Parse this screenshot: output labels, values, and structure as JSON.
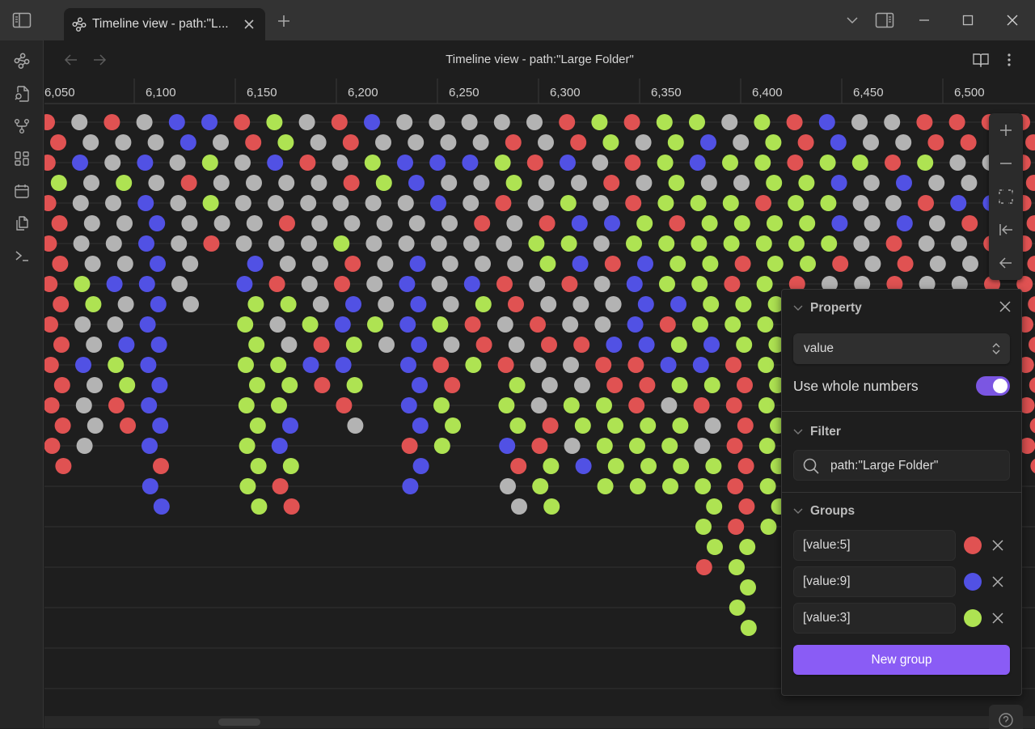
{
  "window": {
    "tab_title": "Timeline view - path:\"L...",
    "tab_icon": "graph-icon",
    "buttons": [
      "sidebar-left-toggle",
      "new-tab",
      "tab-list-dropdown",
      "sidebar-right-toggle",
      "minimize",
      "maximize",
      "close"
    ]
  },
  "ribbon": {
    "items": [
      {
        "name": "graph-view",
        "icon": "graph-icon"
      },
      {
        "name": "file-search",
        "icon": "file-search-icon"
      },
      {
        "name": "git-fork",
        "icon": "fork-icon"
      },
      {
        "name": "dashboard",
        "icon": "layout-grid-icon"
      },
      {
        "name": "calendar",
        "icon": "calendar-icon"
      },
      {
        "name": "copy-files",
        "icon": "copy-icon"
      },
      {
        "name": "command-palette",
        "icon": "terminal-icon"
      }
    ]
  },
  "view_header": {
    "title": "Timeline view - path:\"Large Folder\"",
    "actions": [
      "reading-view",
      "more-options"
    ]
  },
  "timeline": {
    "axis_ticks": [
      "6,050",
      "6,100",
      "6,150",
      "6,200",
      "6,250",
      "6,300",
      "6,350",
      "6,400",
      "6,450",
      "6,500"
    ],
    "colors": {
      "red": "#e05252",
      "blue": "#5151e4",
      "green": "#aee352",
      "gray": "#b3b3b3"
    },
    "legend": {
      "R": "value:5",
      "B": "value:9",
      "G": "value:3",
      "W": "other"
    },
    "columns": [
      {
        "stack": "RRRGRRRRRRRRRRRRRR"
      },
      {
        "stack": "WWBWWWWWGGWWBWWWW"
      },
      {
        "stack": "RWWGWWWWBWWBGGRR"
      },
      {
        "stack": "WWBWBBBBBBBBBBBBBRBB"
      },
      {
        "stack": "BBWRWWWWWW"
      },
      {
        "stack": "BWGWGWR"
      },
      {
        "stack": "RRWWWWWBBGGGGGGGGGGG"
      },
      {
        "stack": "GGBWWRWWRGWWGGGBBGRR"
      },
      {
        "stack": "WWRWWWWWWWGRBR"
      },
      {
        "stack": "RRWRWWGRRBBGBGRW"
      },
      {
        "stack": "BWGGWWWWWWGW"
      },
      {
        "stack": "WWBBWWWBBBBBBBBBRBB"
      },
      {
        "stack": "WWBWBWWWWWGWRRGGG"
      },
      {
        "stack": "WWBWWRWWBGRRG"
      },
      {
        "stack": "WRGGRWWWRRWWRGGGBRWW"
      },
      {
        "stack": "WWRWWRGGWWRRWWWRRGGG"
      },
      {
        "stack": "RRBWGBGBRWWRWWGGWB"
      },
      {
        "stack": "GGWRWBWRWWWBRRGGGGG"
      },
      {
        "stack": "RWRWRGGBBBBBRRRGGGG"
      },
      {
        "stack": "GGGGGRGGGBRGBGWGGGG"
      },
      {
        "stack": "GBBWGGGGGGGBBGRWWGGGGGR"
      },
      {
        "stack": "WWGWGGGRRGGGRRRRRRRRRGGGGG"
      },
      {
        "stack": "GGGGRGGGGGGGGGGGGGGGG"
      },
      {
        "stack": "RRRGGGGGRRBBGRB"
      },
      {
        "stack": "BBGBGBGRWBWWGWWB"
      },
      {
        "stack": "WWGWWWWWWGWRBBG"
      },
      {
        "stack": "WWRBWBRRRRWWGWBR"
      },
      {
        "stack": "RRGWRWWWWRWRGWR"
      },
      {
        "stack": "RRWWBRWWWRWBWWR"
      },
      {
        "stack": "RRWBBRRRRRWWRWRR"
      },
      {
        "stack": "RRRRRRRRRRRRRRRRRR"
      }
    ]
  },
  "zoom_controls": [
    "zoom-in",
    "zoom-out",
    "fit-to-screen",
    "jump-to-start",
    "back"
  ],
  "panel": {
    "property": {
      "heading": "Property",
      "selected": "value",
      "whole_numbers_label": "Use whole numbers",
      "whole_numbers_on": true
    },
    "filter": {
      "heading": "Filter",
      "query": "path:\"Large Folder\""
    },
    "groups": {
      "heading": "Groups",
      "items": [
        {
          "query": "[value:5]",
          "color": "#e05252"
        },
        {
          "query": "[value:9]",
          "color": "#5151e4"
        },
        {
          "query": "[value:3]",
          "color": "#aee352"
        }
      ],
      "new_group_label": "New group"
    }
  }
}
